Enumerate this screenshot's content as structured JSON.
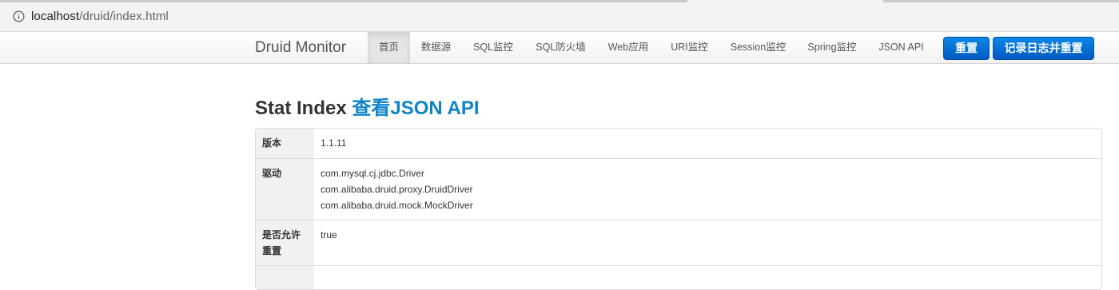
{
  "browser": {
    "url_host": "localhost",
    "url_path": "/druid/index.html"
  },
  "navbar": {
    "brand": "Druid Monitor",
    "items": [
      {
        "label": "首页",
        "active": true
      },
      {
        "label": "数据源"
      },
      {
        "label": "SQL监控"
      },
      {
        "label": "SQL防火墙"
      },
      {
        "label": "Web应用"
      },
      {
        "label": "URI监控"
      },
      {
        "label": "Session监控"
      },
      {
        "label": "Spring监控"
      },
      {
        "label": "JSON API"
      }
    ],
    "buttons": {
      "reset": "重置",
      "log_and_reset": "记录日志并重置"
    }
  },
  "page": {
    "title": "Stat Index",
    "json_link": "查看JSON API"
  },
  "stats": {
    "version": {
      "key": "版本",
      "value": "1.1.11"
    },
    "driver": {
      "key": "驱动",
      "values": [
        "com.mysql.cj.jdbc.Driver",
        "com.alibaba.druid.proxy.DruidDriver",
        "com.alibaba.druid.mock.MockDriver"
      ]
    },
    "allow_reset": {
      "key_line1": "是否允许",
      "key_line2": "重置",
      "value": "true"
    }
  },
  "colors": {
    "primary_button": "#0a6fd8",
    "link": "#0e84c7",
    "active_nav": "#e5e5e5"
  }
}
